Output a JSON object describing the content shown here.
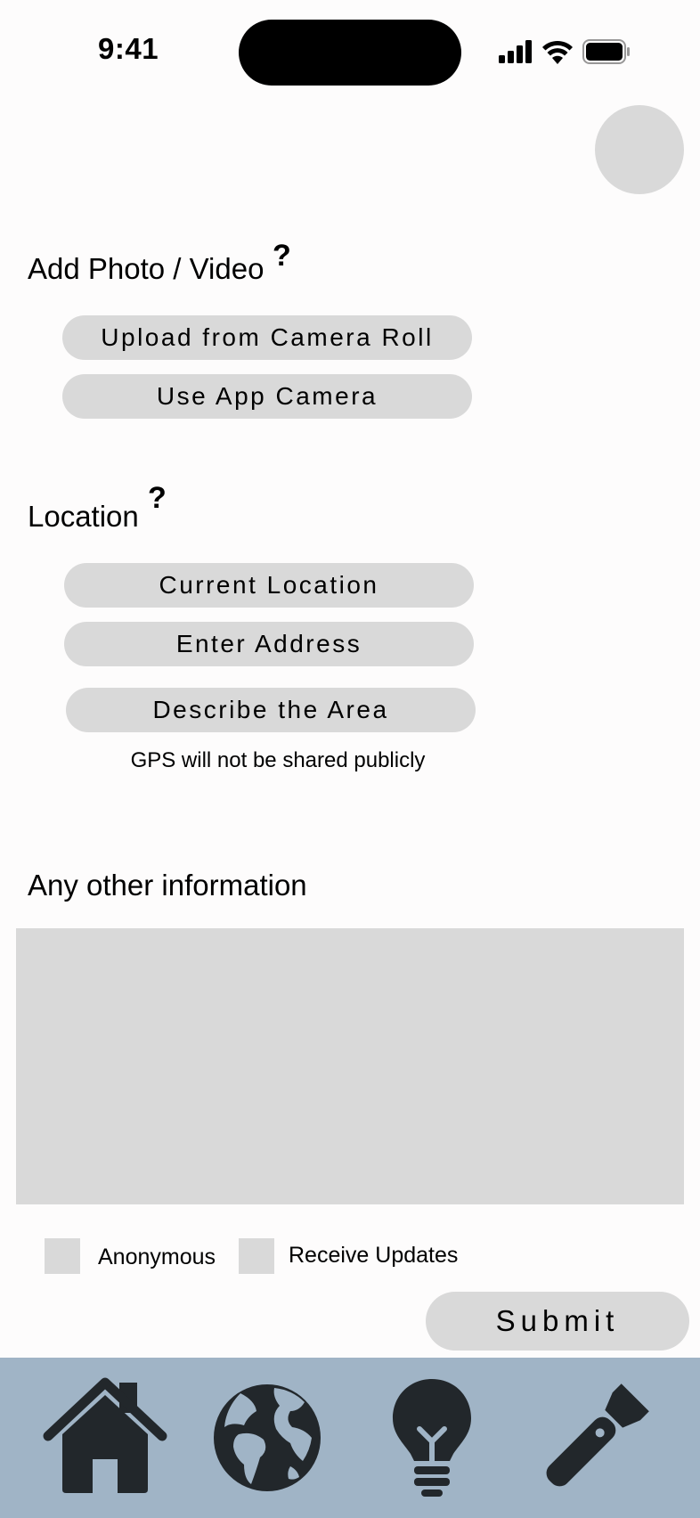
{
  "status_bar": {
    "time": "9:41",
    "icons": [
      "signal-icon",
      "wifi-icon",
      "battery-icon"
    ]
  },
  "photo_section": {
    "title": "Add Photo / Video",
    "help": "?",
    "buttons": {
      "camera_roll": "Upload from Camera Roll",
      "app_camera": "Use App Camera"
    }
  },
  "location_section": {
    "title": "Location",
    "help": "?",
    "buttons": {
      "current": "Current Location",
      "address": "Enter Address",
      "describe": "Describe the Area"
    },
    "note": "GPS will not be shared publicly"
  },
  "info_section": {
    "title": "Any other information",
    "value": ""
  },
  "options": {
    "anonymous": "Anonymous",
    "updates": "Receive Updates"
  },
  "submit_label": "Submit",
  "tab_bar": {
    "tabs": [
      "home-icon",
      "globe-icon",
      "lightbulb-icon",
      "flashlight-icon"
    ]
  },
  "colors": {
    "control_gray": "#d9d9d9",
    "tab_bar_bg": "#a0b4c6",
    "icon_dark": "#22272b"
  }
}
